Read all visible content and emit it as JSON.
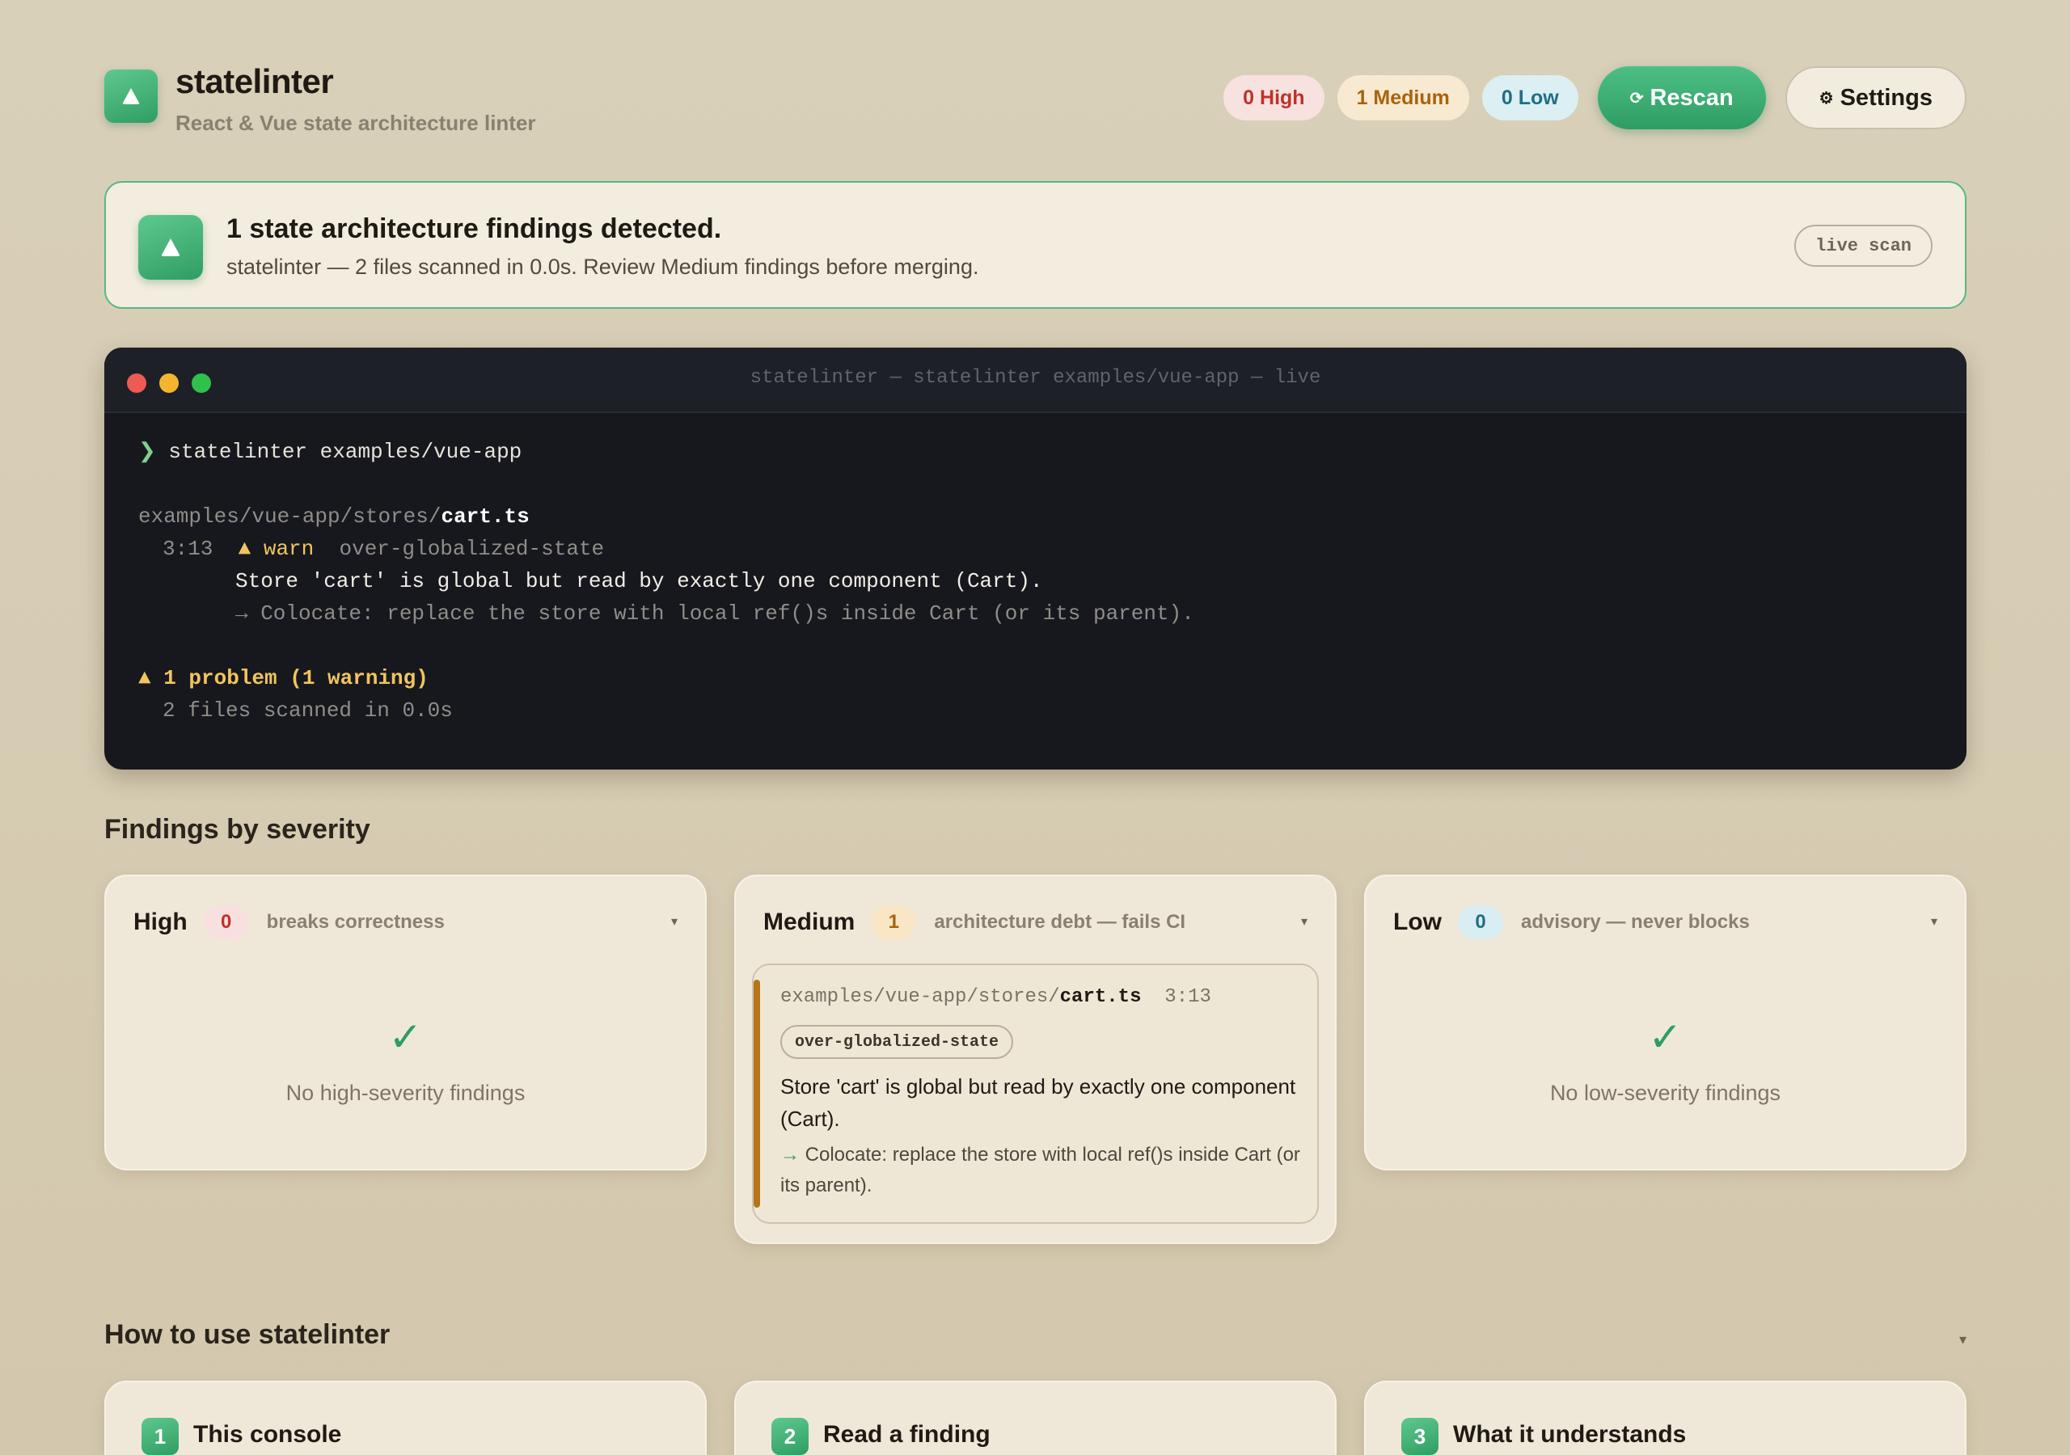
{
  "header": {
    "title": "statelinter",
    "subtitle": "React & Vue state architecture linter",
    "pills": {
      "high": "0 High",
      "medium": "1 Medium",
      "low": "0 Low"
    },
    "rescan_label": "Rescan",
    "settings_label": "Settings",
    "rescan_icon": "refresh-icon",
    "settings_icon": "gear-icon"
  },
  "banner": {
    "title": "1 state architecture findings detected.",
    "text": "statelinter — 2 files scanned in 0.0s. Review Medium findings before merging.",
    "tag": "live scan"
  },
  "terminal": {
    "title": "statelinter — statelinter examples/vue-app — live",
    "prompt_symbol": "❯",
    "command": "statelinter examples/vue-app",
    "file_dir": "examples/vue-app/stores/",
    "file_name": "cart.ts",
    "location": "3:13",
    "level": "▲ warn",
    "rule": "over-globalized-state",
    "message": "Store 'cart' is global but read by exactly one component (Cart).",
    "fix": "→ Colocate: replace the store with local ref()s inside Cart (or its parent).",
    "summary": "▲ 1 problem (1 warning)",
    "scanned": "2 files scanned in 0.0s"
  },
  "findings": {
    "section_title": "Findings by severity",
    "high": {
      "title": "High",
      "count": "0",
      "desc": "breaks correctness",
      "empty": "No high-severity findings"
    },
    "medium": {
      "title": "Medium",
      "count": "1",
      "desc": "architecture debt — fails CI",
      "item": {
        "dir": "examples/vue-app/stores/",
        "file": "cart.ts",
        "loc": "3:13",
        "rule": "over-globalized-state",
        "message": "Store 'cart' is global but read by exactly one component (Cart).",
        "fix_arrow": "→",
        "fix": "Colocate: replace the store with local ref()s inside Cart (or its parent)."
      }
    },
    "low": {
      "title": "Low",
      "count": "0",
      "desc": "advisory — never blocks",
      "empty": "No low-severity findings"
    },
    "check": "✓",
    "chevron": "▾"
  },
  "howto": {
    "title": "How to use statelinter",
    "steps": [
      {
        "num": "1",
        "title": "This console"
      },
      {
        "num": "2",
        "title": "Read a finding"
      },
      {
        "num": "3",
        "title": "What it understands"
      }
    ]
  },
  "colors": {
    "accent": "#2f9d63",
    "high": "#c0312b",
    "medium": "#a9620e",
    "low": "#1f6f85"
  }
}
